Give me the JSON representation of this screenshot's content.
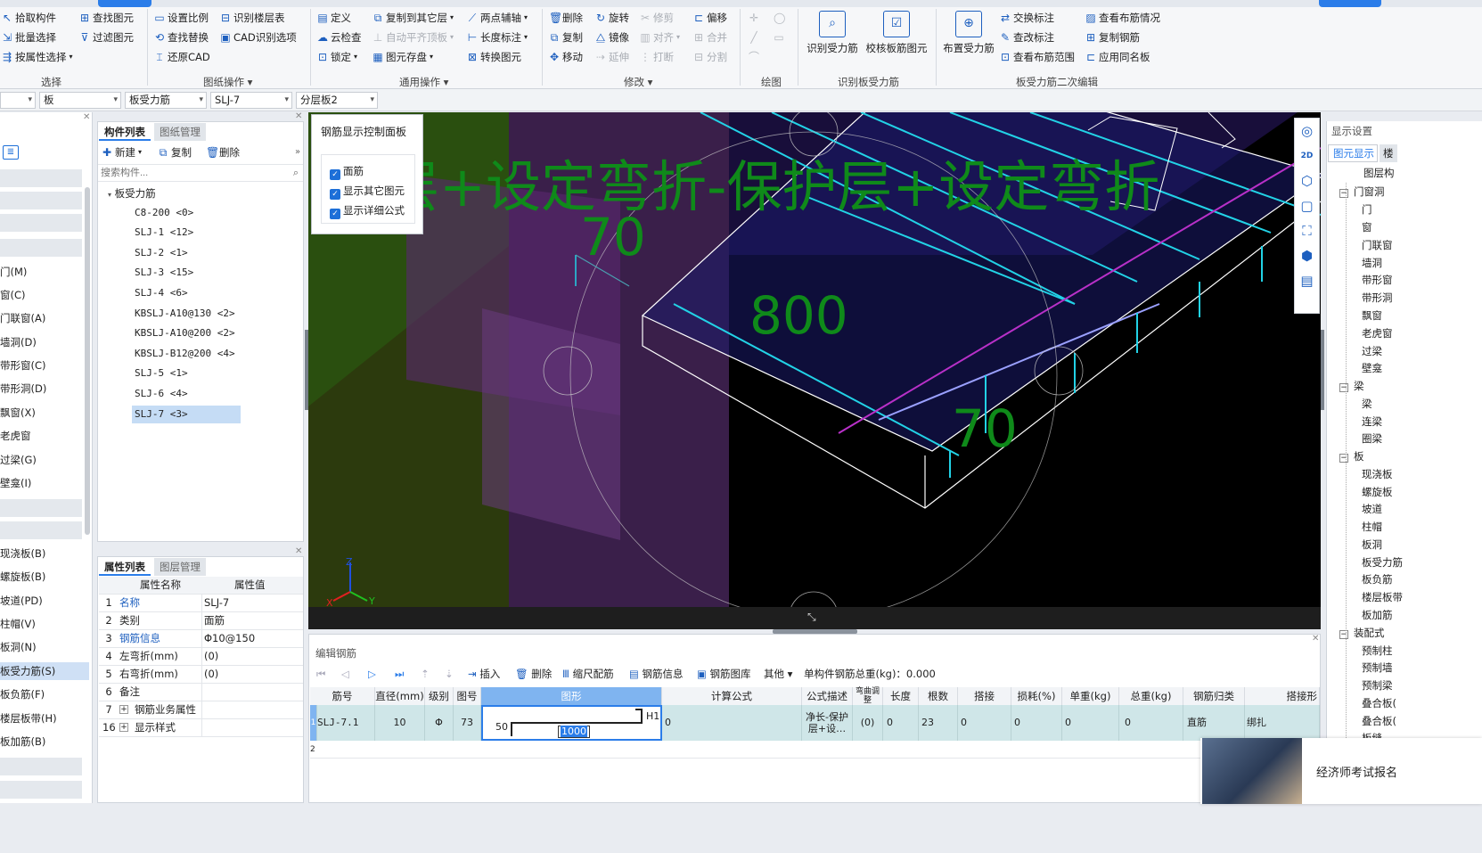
{
  "ribbon": {
    "col1": [
      "拾取构件",
      "批量选择",
      "按属性选择"
    ],
    "col2": [
      "查找图元",
      "过滤图元"
    ],
    "group_select": "选择",
    "col3": [
      "设置比例",
      "查找替换",
      "还原CAD"
    ],
    "col4": [
      "识别楼层表",
      "CAD识别选项"
    ],
    "group_drawing": "图纸操作",
    "col5": [
      "定义",
      "云检查",
      "锁定"
    ],
    "col6": [
      "复制到其它层",
      "自动平齐顶板",
      "图元存盘"
    ],
    "col7": [
      "两点辅轴",
      "长度标注",
      "转换图元"
    ],
    "group_general": "通用操作",
    "col8": [
      "删除",
      "复制",
      "移动"
    ],
    "col9": [
      "旋转",
      "镜像",
      "延伸"
    ],
    "col10": [
      "修剪",
      "对齐",
      "打断"
    ],
    "col11": [
      "偏移",
      "合并",
      "分割"
    ],
    "group_modify": "修改",
    "group_draw": "绘图",
    "big1": "识别受力筋",
    "big2": "校核板筋图元",
    "group_identify": "识别板受力筋",
    "big3": "布置受力筋",
    "col12": [
      "交换标注",
      "查改标注",
      "查看布筋范围"
    ],
    "col13": [
      "查看布筋情况",
      "复制钢筋",
      "应用同名板"
    ],
    "group_edit2": "板受力筋二次编辑"
  },
  "filterbar": {
    "dd1": "",
    "dd2": "板",
    "dd3": "板受力筋",
    "dd4": "SLJ-7",
    "dd5": "分层板2"
  },
  "nav": [
    "门(M)",
    "窗(C)",
    "门联窗(A)",
    "墙洞(D)",
    "带形窗(C)",
    "带形洞(D)",
    "飘窗(X)",
    "老虎窗",
    "过梁(G)",
    "壁龛(I)",
    "现浇板(B)",
    "螺旋板(B)",
    "坡道(PD)",
    "柱帽(V)",
    "板洞(N)",
    "板受力筋(S)",
    "板负筋(F)",
    "楼层板带(H)",
    "板加筋(B)"
  ],
  "component_panel": {
    "tab_active": "构件列表",
    "tab2": "图纸管理",
    "new": "新建",
    "copy": "复制",
    "delete": "删除",
    "search_placeholder": "搜索构件...",
    "tree_root": "板受力筋",
    "items": [
      "C8-200 <0>",
      "SLJ-1 <12>",
      "SLJ-2 <1>",
      "SLJ-3 <15>",
      "SLJ-4 <6>",
      "KBSLJ-A10@130 <2>",
      "KBSLJ-A10@200 <2>",
      "KBSLJ-B12@200 <4>",
      "SLJ-5 <1>",
      "SLJ-6 <4>",
      "SLJ-7 <3>"
    ]
  },
  "props_panel": {
    "tab_active": "属性列表",
    "tab2": "图层管理",
    "col_name": "属性名称",
    "col_value": "属性值",
    "rows": [
      {
        "no": "1",
        "name": "名称",
        "value": "SLJ-7"
      },
      {
        "no": "2",
        "name": "类别",
        "value": "面筋"
      },
      {
        "no": "3",
        "name": "钢筋信息",
        "value": "Φ10@150"
      },
      {
        "no": "4",
        "name": "左弯折(mm)",
        "value": "(0)"
      },
      {
        "no": "5",
        "name": "右弯折(mm)",
        "value": "(0)"
      },
      {
        "no": "6",
        "name": "备注",
        "value": ""
      },
      {
        "no": "7",
        "name": "钢筋业务属性",
        "value": ""
      },
      {
        "no": "16",
        "name": "显示样式",
        "value": ""
      }
    ]
  },
  "viewport": {
    "panel_title": "钢筋显示控制面板",
    "chk1": "面筋",
    "chk2": "显示其它图元",
    "chk3": "显示详细公式",
    "formula_text": "层+设定弯折-保护层+设定弯折",
    "dim_top": "70",
    "dim_mid": "800",
    "dim_right": "70",
    "axis_z": "Z",
    "axis_x": "X",
    "axis_y": "Y"
  },
  "edit_panel": {
    "title": "编辑钢筋",
    "insert": "插入",
    "delete": "删除",
    "scale": "缩尺配筋",
    "info": "钢筋信息",
    "lib": "钢筋图库",
    "other": "其他",
    "total": "单构件钢筋总重(kg)：0.000",
    "headers": [
      "筋号",
      "直径(mm)",
      "级别",
      "图号",
      "图形",
      "计算公式",
      "公式描述",
      "弯曲调整",
      "长度",
      "根数",
      "搭接",
      "损耗(%)",
      "单重(kg)",
      "总重(kg)",
      "钢筋归类",
      "搭接形"
    ],
    "row": {
      "no": "1",
      "bar": "SLJ-7.1",
      "dia": "10",
      "grade": "Φ",
      "fig": "73",
      "shape_left": "50",
      "shape_len": "1000",
      "shape_right": "H1",
      "formula": "0",
      "desc": "净长-保护层+设…",
      "bend": "(0)",
      "length": "0",
      "count": "23",
      "lap": "0",
      "loss": "0",
      "unit_w": "0",
      "total_w": "0",
      "category": "直筋",
      "lap_type": "绑扎"
    },
    "row2_no": "2"
  },
  "right_panel": {
    "title": "显示设置",
    "tab1": "图元显示",
    "tab2": "楼",
    "col_head": "图层构",
    "groups": [
      {
        "name": "门窗洞",
        "items": [
          "门",
          "窗",
          "门联窗",
          "墙洞",
          "带形窗",
          "带形洞",
          "飘窗",
          "老虎窗",
          "过梁",
          "壁龛"
        ]
      },
      {
        "name": "梁",
        "items": [
          "梁",
          "连梁",
          "圈梁"
        ]
      },
      {
        "name": "板",
        "items": [
          "现浇板",
          "螺旋板",
          "坡道",
          "柱帽",
          "板洞",
          "板受力筋",
          "板负筋",
          "楼层板带",
          "板加筋"
        ]
      },
      {
        "name": "装配式",
        "items": [
          "预制柱",
          "预制墙",
          "预制梁",
          "叠合板(",
          "叠合板(",
          "板缝"
        ]
      }
    ]
  },
  "ad": {
    "text": "经济师考试报名"
  },
  "colors": {
    "accent": "#2b7de9",
    "cyan": "#1fd3e6",
    "green_text": "#0f8a1a"
  }
}
